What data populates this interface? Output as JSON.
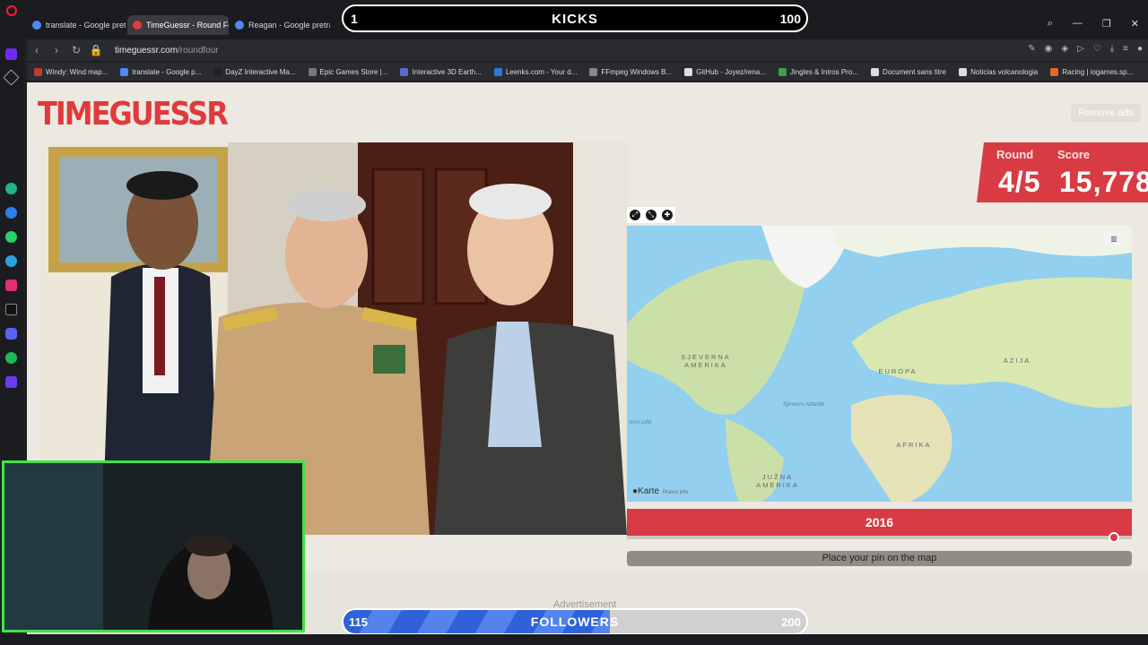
{
  "browser": {
    "tabs": [
      {
        "label": "translate - Google pretraži",
        "color": "#4a8cf0"
      },
      {
        "label": "TimeGuessr - Round Four",
        "color": "#e03a3c",
        "active": true
      },
      {
        "label": "Reagan - Google pretraži",
        "color": "#4a8cf0"
      }
    ],
    "url_host": "timeguessr.com",
    "url_path": "/roundfour",
    "bookmarks": [
      {
        "label": "Windy: Wind map...",
        "color": "#c0392b"
      },
      {
        "label": "translate - Google p...",
        "color": "#4a8cf0"
      },
      {
        "label": "DayZ Interactive Ma...",
        "color": "#222222"
      },
      {
        "label": "Epic Games Store |...",
        "color": "#777777"
      },
      {
        "label": "Interactive 3D Earth...",
        "color": "#5a6bd8"
      },
      {
        "label": "Leenks.com - Your d...",
        "color": "#2a7ad8"
      },
      {
        "label": "FFmpeg Windows B...",
        "color": "#888888"
      },
      {
        "label": "GitHub - Joyez/rena...",
        "color": "#dddddd"
      },
      {
        "label": "Jingles & Intros Pro...",
        "color": "#3aa04a"
      },
      {
        "label": "Document sans titre",
        "color": "#dddddd"
      },
      {
        "label": "Noticias volcanologia",
        "color": "#dddddd"
      },
      {
        "label": "Racing | iogames.sp...",
        "color": "#e06a2a"
      }
    ]
  },
  "game": {
    "logo": "TIMEGUESSR",
    "remove_ads": "Remove ads",
    "round_label": "Round",
    "round_value": "4/5",
    "score_label": "Score",
    "score_value": "15,778",
    "year": "2016",
    "year_fraction": 0.92,
    "place_pin": "Place your pin on the map",
    "advertisement": "Advertisement"
  },
  "map": {
    "labels": {
      "north_america": "SJEVERNA AMERIKA",
      "europe": "EUROPA",
      "asia": "AZIJA",
      "africa": "AFRIKA",
      "south_america": "JUŽNA AMERIKA",
      "atlantic": "Sjeverni Atlantik",
      "pacific": "evni cifik"
    },
    "attribution": "Karte",
    "legal": "Pravni info"
  },
  "overlay": {
    "kicks_current": "1",
    "kicks_label": "KICKS",
    "kicks_goal": "100",
    "kicks_fraction": 0.01,
    "followers_current": "115",
    "followers_label": "FOLLOWERS",
    "followers_goal": "200",
    "followers_fraction": 0.575
  },
  "colors": {
    "accent_red": "#d83b43",
    "page_bg": "#ebe9e1",
    "webcam_border": "#3fe24a",
    "progress_blue": "#2f62d8"
  }
}
